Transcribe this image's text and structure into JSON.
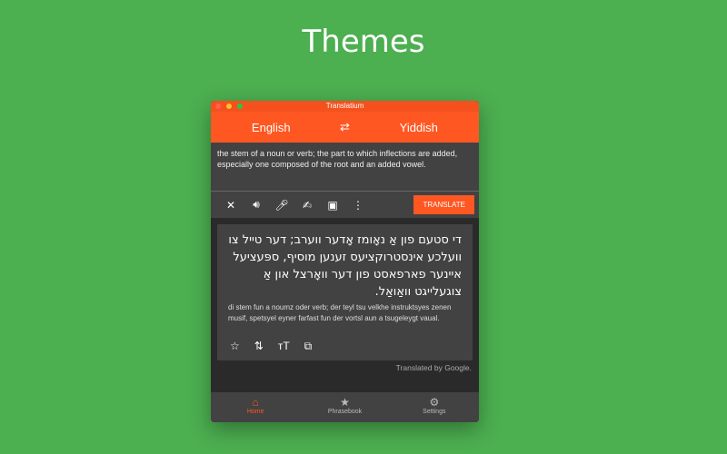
{
  "page": {
    "title": "Themes"
  },
  "window": {
    "title": "Translatium"
  },
  "header": {
    "source_lang": "English",
    "target_lang": "Yiddish"
  },
  "input": {
    "value": "the stem of a noun or verb; the part to which inflections are added, especially one composed of the root and an added vowel."
  },
  "toolbar": {
    "translate_label": "TRANSLATE"
  },
  "result": {
    "text": "די סטעם פון אַ נאָומז אָדער ווערב; דער טייל צו וועלכע אינסטרוקציעס זענען מוסיף, ספּעציעל איינער פארפאסט פון דער וואָרצל און אַ צוגעלייגט וואַואַל.",
    "romanization": "di stem fun a noumz oder verb; der teyl tsu velkhe instruktsyes zenen musif, spetsyel eyner farfast fun der vortsl aun a tsugeleygt vaual.",
    "attribution": "Translated by Google."
  },
  "nav": {
    "items": [
      {
        "label": "Home",
        "icon": "home-icon",
        "active": true
      },
      {
        "label": "Phrasebook",
        "icon": "star-icon"
      },
      {
        "label": "Settings",
        "icon": "gear-icon"
      }
    ]
  },
  "colors": {
    "background": "#4caf50",
    "accent": "#ff5722"
  }
}
